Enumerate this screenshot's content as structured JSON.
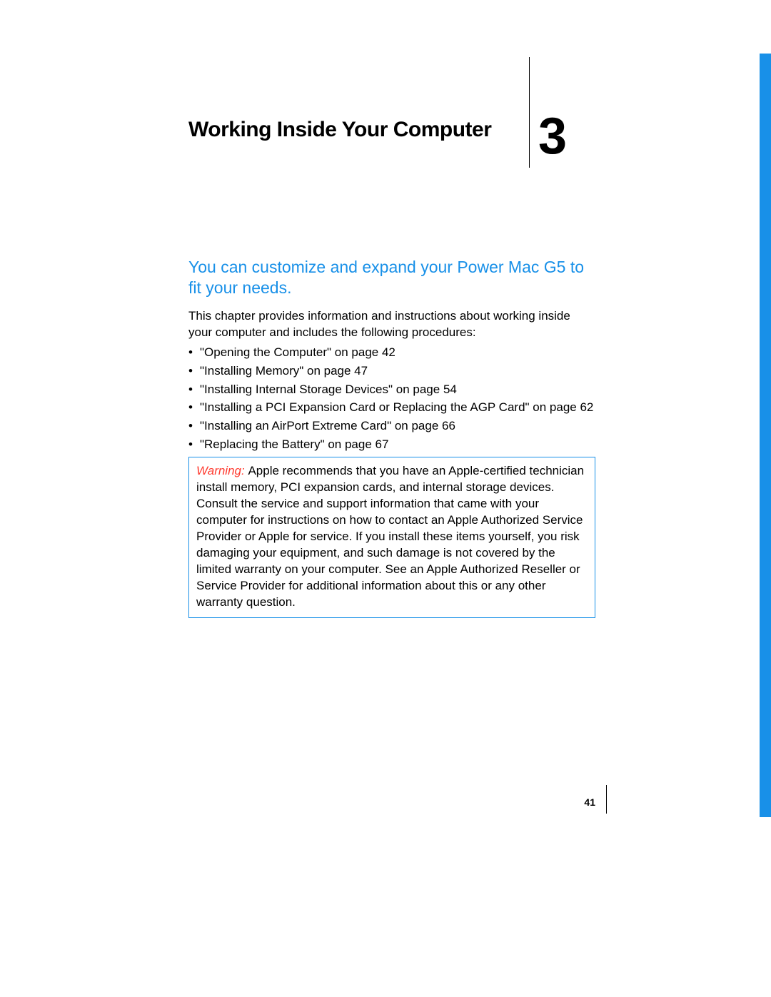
{
  "chapter": {
    "title": "Working Inside Your Computer",
    "number": "3"
  },
  "lead": "You can customize and expand your Power Mac G5 to fit your needs.",
  "intro": "This chapter provides information and instructions about working inside your computer and includes the following procedures:",
  "bullets": [
    "\"Opening the Computer\" on page 42",
    "\"Installing Memory\" on page 47",
    "\"Installing Internal Storage Devices\" on page 54",
    "\"Installing a PCI Expansion Card or Replacing the AGP Card\" on page 62",
    "\"Installing an AirPort Extreme Card\" on page 66",
    "\"Replacing the Battery\" on page 67"
  ],
  "warning": {
    "label": "Warning:  ",
    "text": "Apple recommends that you have an Apple-certified technician install memory, PCI expansion cards, and internal storage devices. Consult the service and support information that came with your computer for instructions on how to contact an Apple Authorized Service Provider or Apple for service. If you install these items yourself, you risk damaging your equipment, and such damage is not covered by the limited warranty on your computer. See an Apple Authorized Reseller or Service Provider for additional information about this or any other warranty question."
  },
  "folio": "41"
}
